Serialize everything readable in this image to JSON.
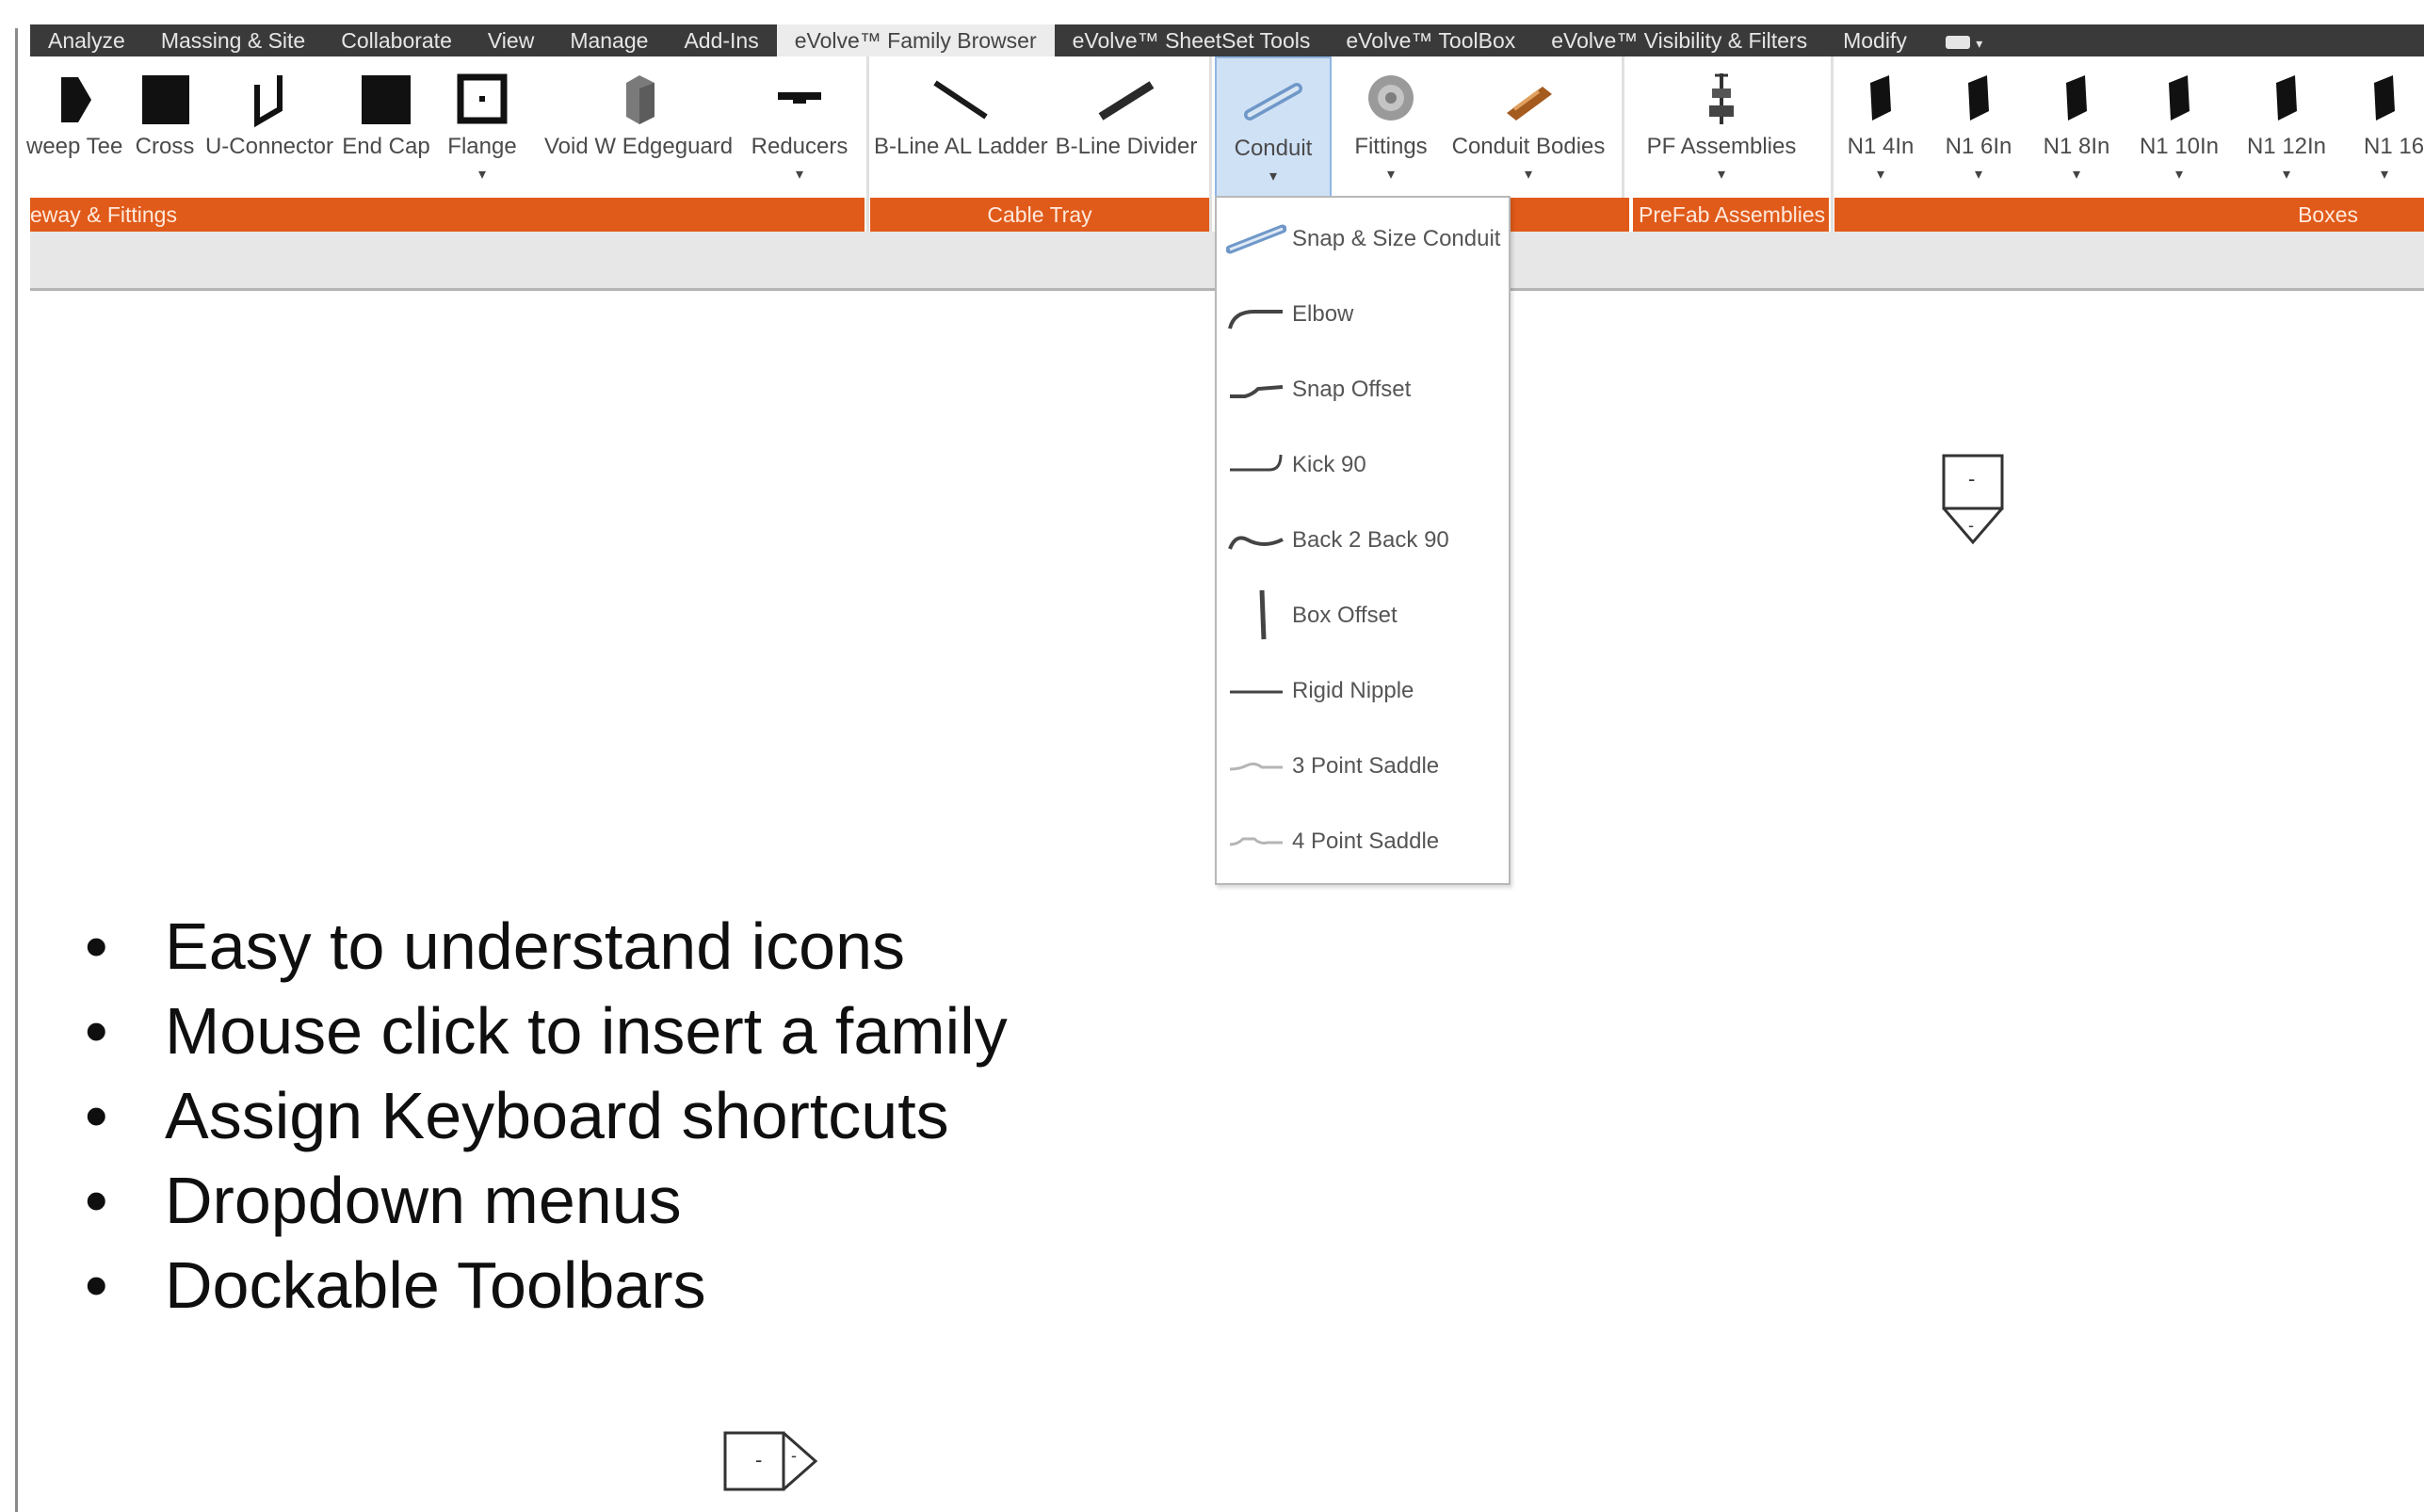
{
  "menu": {
    "tabs": [
      "Analyze",
      "Massing & Site",
      "Collaborate",
      "View",
      "Manage",
      "Add-Ins",
      "eVolve™ Family Browser",
      "eVolve™ SheetSet Tools",
      "eVolve™ ToolBox",
      "eVolve™ Visibility & Filters",
      "Modify"
    ]
  },
  "ribbon": {
    "tools": {
      "sweep_tee": "weep Tee",
      "cross": "Cross",
      "u_connector": "U-Connector",
      "end_cap": "End Cap",
      "flange": "Flange",
      "void_w_edgeguard": "Void W Edgeguard",
      "reducers": "Reducers",
      "bline_al_ladder": "B-Line AL Ladder",
      "bline_divider": "B-Line Divider",
      "conduit": "Conduit",
      "fittings": "Fittings",
      "conduit_bodies": "Conduit Bodies",
      "pf_assemblies": "PF Assemblies",
      "n1_4in": "N1 4In",
      "n1_6in": "N1 6In",
      "n1_8in": "N1 8In",
      "n1_10in": "N1 10In",
      "n1_12in": "N1 12In",
      "n1_16": "N1 16"
    },
    "panels": {
      "raceway_fittings": "eway & Fittings",
      "cable_tray": "Cable Tray",
      "prefab_assemblies": "PreFab Assemblies",
      "boxes": "Boxes"
    }
  },
  "dropdown": {
    "items": [
      "Snap & Size Conduit",
      "Elbow",
      "Snap Offset",
      "Kick 90",
      "Back 2 Back 90",
      "Box Offset",
      "Rigid Nipple",
      "3 Point Saddle",
      "4 Point Saddle"
    ]
  },
  "canvas": {
    "tag_glyph": "-"
  },
  "bullets": [
    "Easy to understand icons",
    "Mouse click to insert a family",
    "Assign Keyboard shortcuts",
    "Dropdown menus",
    "Dockable Toolbars"
  ],
  "bullet_symbol": "•"
}
